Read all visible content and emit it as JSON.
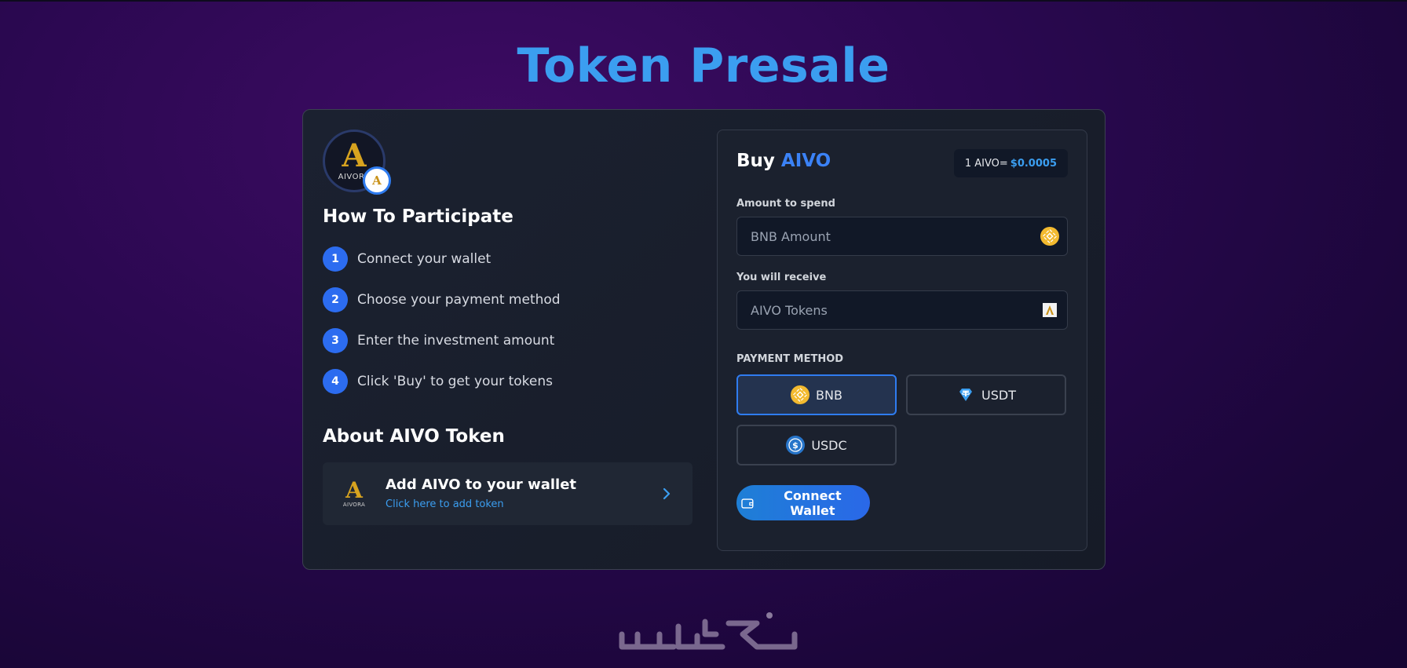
{
  "page": {
    "title": "Token Presale"
  },
  "participate": {
    "logo_text": "AIVORA",
    "title": "How To Participate",
    "steps": [
      {
        "num": "1",
        "text": "Connect your wallet"
      },
      {
        "num": "2",
        "text": "Choose your payment method"
      },
      {
        "num": "3",
        "text": "Enter the investment amount"
      },
      {
        "num": "4",
        "text": "Click 'Buy' to get your tokens"
      }
    ]
  },
  "about": {
    "title": "About AIVO Token",
    "add_token": {
      "logo_text": "AIVORA",
      "title": "Add AIVO to your wallet",
      "subtitle": "Click here to add token"
    }
  },
  "buy": {
    "title_prefix": "Buy",
    "title_accent": "AIVO",
    "price_label": "1 AIVO=",
    "price_value": "$0.0005",
    "amount_label": "Amount to spend",
    "amount_placeholder": "BNB Amount",
    "amount_value": "",
    "receive_label": "You will receive",
    "receive_placeholder": "AIVO Tokens",
    "receive_value": "",
    "payment_label": "PAYMENT METHOD",
    "payment_methods": [
      {
        "label": "BNB",
        "icon": "bnb-icon",
        "selected": true
      },
      {
        "label": "USDT",
        "icon": "usdt-icon",
        "selected": false
      },
      {
        "label": "USDC",
        "icon": "usdc-icon",
        "selected": false
      }
    ],
    "connect_label": "Connect Wallet"
  },
  "colors": {
    "accent": "#3b9ef0",
    "primary_blue": "#2c6cf0",
    "bnb_gold": "#f3ba2f",
    "usdt_teal": "#26a17b",
    "usdc_blue": "#2775ca",
    "background": "#2a0850"
  }
}
